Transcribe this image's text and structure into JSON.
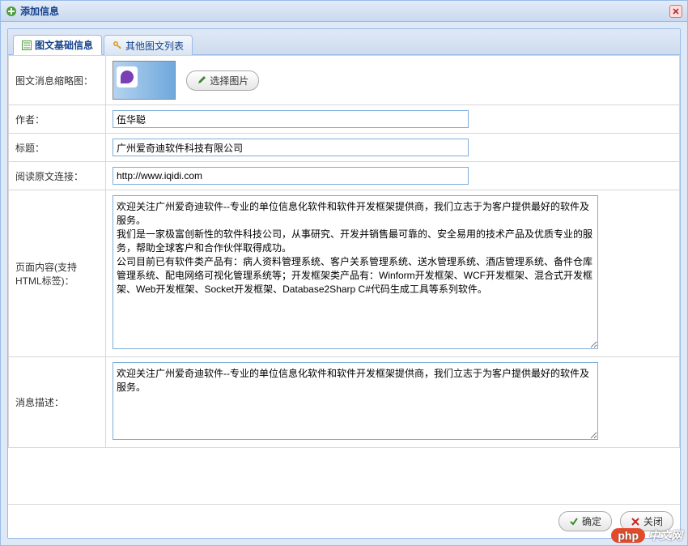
{
  "window": {
    "title": "添加信息"
  },
  "tabs": [
    {
      "label": "图文基础信息",
      "active": true
    },
    {
      "label": "其他图文列表",
      "active": false
    }
  ],
  "form": {
    "thumbnail_label": "图文消息缩略图：",
    "choose_image_label": "选择图片",
    "author_label": "作者：",
    "author_value": "伍华聪",
    "title_label": "标题：",
    "title_value": "广州爱奇迪软件科技有限公司",
    "url_label": "阅读原文连接：",
    "url_value": "http://www.iqidi.com",
    "content_label": "页面内容(支持HTML标签)：",
    "content_value": "欢迎关注广州爱奇迪软件--专业的单位信息化软件和软件开发框架提供商，我们立志于为客户提供最好的软件及服务。\n我们是一家极富创新性的软件科技公司，从事研究、开发并销售最可靠的、安全易用的技术产品及优质专业的服务，帮助全球客户和合作伙伴取得成功。\n公司目前已有软件类产品有：病人资料管理系统、客户关系管理系统、送水管理系统、酒店管理系统、备件仓库管理系统、配电网络可视化管理系统等；开发框架类产品有：Winform开发框架、WCF开发框架、混合式开发框架、Web开发框架、Socket开发框架、Database2Sharp C#代码生成工具等系列软件。",
    "desc_label": "消息描述：",
    "desc_value": "欢迎关注广州爱奇迪软件--专业的单位信息化软件和软件开发框架提供商，我们立志于为客户提供最好的软件及服务。"
  },
  "actions": {
    "ok_label": "确定",
    "close_label": "关闭"
  },
  "watermark": {
    "badge": "php",
    "text": "中文网"
  }
}
